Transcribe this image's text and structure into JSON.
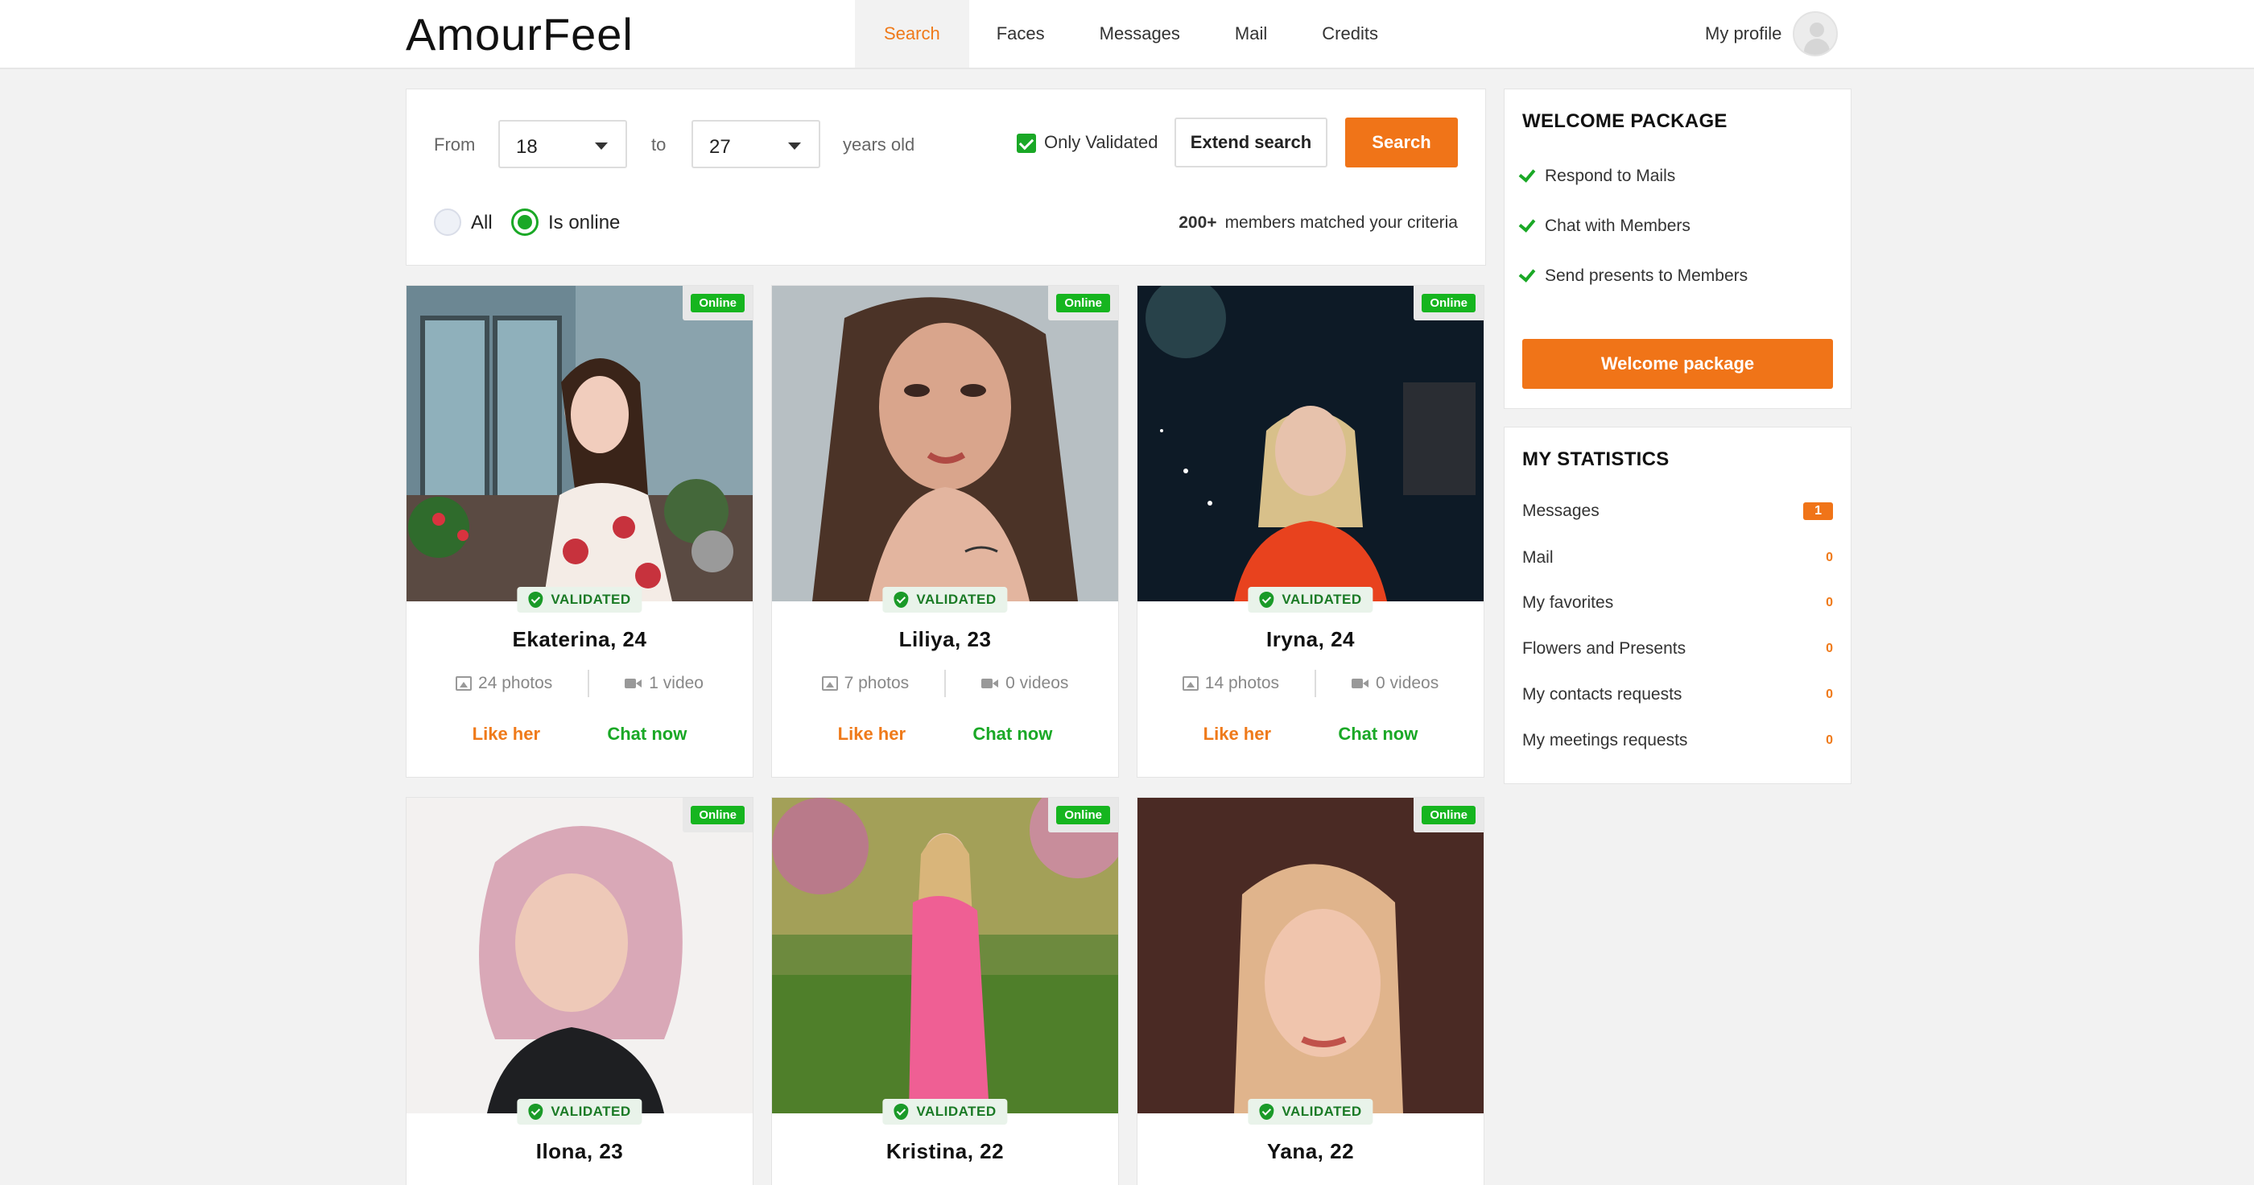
{
  "brand": "AmourFeel",
  "nav": [
    "Search",
    "Faces",
    "Messages",
    "Mail",
    "Credits"
  ],
  "profile": {
    "label": "My profile"
  },
  "filter": {
    "from_label": "From",
    "from_value": "18",
    "to_label": "to",
    "to_value": "27",
    "years_label": "years old",
    "only_validated_label": "Only Validated",
    "extend_label": "Extend search",
    "search_label": "Search",
    "radio_all": "All",
    "radio_online": "Is online",
    "matched_count": "200+",
    "matched_text": "members matched your criteria"
  },
  "cards": [
    {
      "name": "Ekaterina, 24",
      "photos": "24 photos",
      "videos": "1 video",
      "online": "Online",
      "validated": "VALIDATED",
      "like": "Like her",
      "chat": "Chat now"
    },
    {
      "name": "Liliya, 23",
      "photos": "7 photos",
      "videos": "0 videos",
      "online": "Online",
      "validated": "VALIDATED",
      "like": "Like her",
      "chat": "Chat now"
    },
    {
      "name": "Iryna, 24",
      "photos": "14 photos",
      "videos": "0 videos",
      "online": "Online",
      "validated": "VALIDATED",
      "like": "Like her",
      "chat": "Chat now"
    },
    {
      "name": "Ilona, 23",
      "online": "Online",
      "validated": "VALIDATED"
    },
    {
      "name": "Kristina, 22",
      "online": "Online",
      "validated": "VALIDATED"
    },
    {
      "name": "Yana, 22",
      "online": "Online",
      "validated": "VALIDATED"
    }
  ],
  "welcome": {
    "title": "WELCOME PACKAGE",
    "items": [
      "Respond to Mails",
      "Chat with Members",
      "Send presents to Members"
    ],
    "button": "Welcome package"
  },
  "stats": {
    "title": "MY STATISTICS",
    "rows": [
      {
        "label": "Messages",
        "value": "1"
      },
      {
        "label": "Mail",
        "value": "0"
      },
      {
        "label": "My favorites",
        "value": "0"
      },
      {
        "label": "Flowers and Presents",
        "value": "0"
      },
      {
        "label": "My contacts requests",
        "value": "0"
      },
      {
        "label": "My meetings requests",
        "value": "0"
      }
    ]
  },
  "colors": {
    "accent": "#f07418",
    "online": "#16b51f",
    "validated": "#1a9a28"
  }
}
